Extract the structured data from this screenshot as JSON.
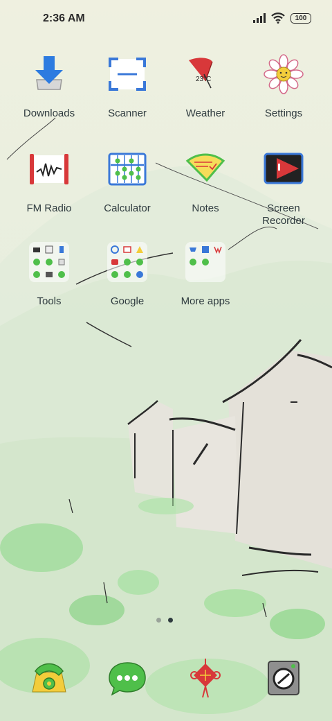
{
  "status_bar": {
    "time": "2:36 AM",
    "battery": "100",
    "icons": [
      "signal-icon",
      "wifi-icon",
      "battery-icon"
    ]
  },
  "apps": {
    "row1": [
      {
        "label": "Downloads",
        "icon": "download-arrow-icon"
      },
      {
        "label": "Scanner",
        "icon": "scanner-frame-icon"
      },
      {
        "label": "Weather",
        "icon": "red-umbrella-icon",
        "badge": "23°C"
      },
      {
        "label": "Settings",
        "icon": "flower-gear-icon"
      }
    ],
    "row2": [
      {
        "label": "FM Radio",
        "icon": "radio-wave-icon"
      },
      {
        "label": "Calculator",
        "icon": "abacus-icon"
      },
      {
        "label": "Notes",
        "icon": "paper-fan-icon"
      },
      {
        "label": "Screen\nRecorder",
        "icon": "record-screen-icon"
      }
    ],
    "row3": [
      {
        "label": "Tools",
        "icon": "folder-icon"
      },
      {
        "label": "Google",
        "icon": "folder-icon"
      },
      {
        "label": "More apps",
        "icon": "folder-icon"
      }
    ]
  },
  "page_indicator": {
    "pages": 2,
    "active": 2
  },
  "dock": [
    {
      "name": "phone",
      "icon": "phone-icon"
    },
    {
      "name": "messages",
      "icon": "messages-icon"
    },
    {
      "name": "browser",
      "icon": "chinese-knot-icon"
    },
    {
      "name": "camera",
      "icon": "camera-icon"
    }
  ],
  "colors": {
    "label_text": "#2f3b3f",
    "accent_red": "#d8383a",
    "accent_blue": "#3a78d8",
    "accent_green": "#4fbf4a"
  }
}
